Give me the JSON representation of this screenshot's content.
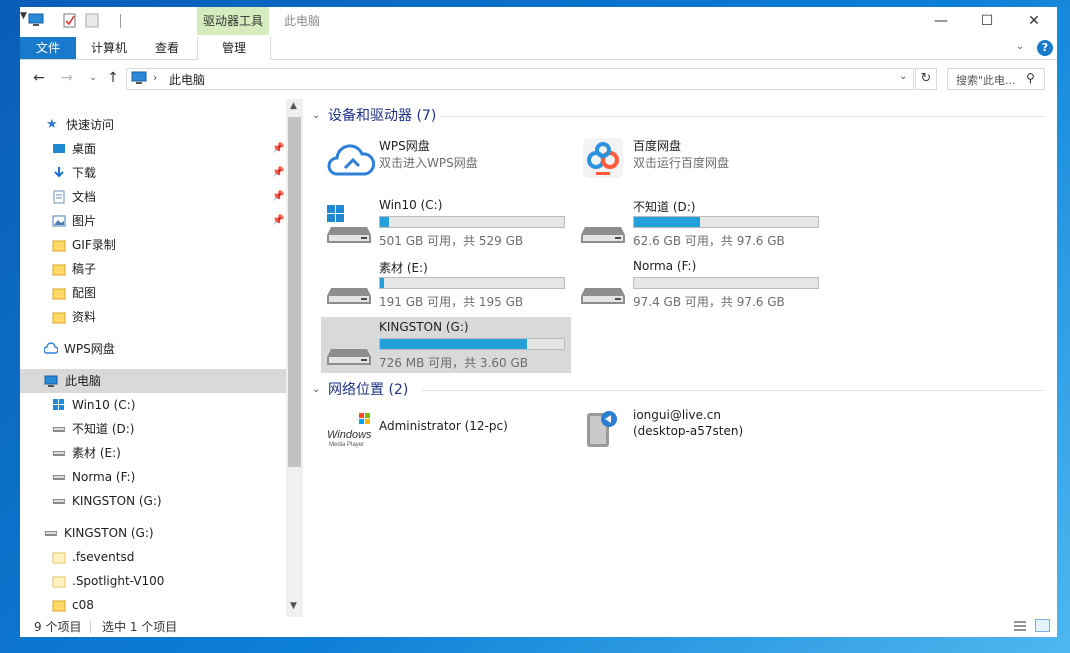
{
  "titlebar": {
    "context_tab": "驱动器工具",
    "window_title": "此电脑",
    "minimize_glyph": "—",
    "maximize_glyph": "☐",
    "close_glyph": "✕"
  },
  "ribbon": {
    "tabs": [
      "文件",
      "计算机",
      "查看",
      "管理"
    ],
    "help_glyph": "?"
  },
  "address": {
    "path": "此电脑",
    "search_placeholder": "搜索\"此电..."
  },
  "nav": {
    "quick_access": "快速访问",
    "quick_items": [
      "桌面",
      "下载",
      "文档",
      "图片",
      "GIF录制",
      "稿子",
      "配图",
      "资料"
    ],
    "wps": "WPS网盘",
    "this_pc": "此电脑",
    "drives": [
      "Win10 (C:)",
      "不知道 (D:)",
      "素材 (E:)",
      "Norma (F:)",
      "KINGSTON (G:)"
    ],
    "kingston": "KINGSTON (G:)",
    "kingston_items": [
      ".fseventsd",
      ".Spotlight-V100",
      "c08"
    ]
  },
  "content": {
    "devices_header": "设备和驱动器 (7)",
    "network_header": "网络位置 (2)",
    "cloud": [
      {
        "name": "WPS网盘",
        "sub": "双击进入WPS网盘"
      },
      {
        "name": "百度网盘",
        "sub": "双击运行百度网盘"
      }
    ],
    "drives": [
      {
        "name": "Win10 (C:)",
        "free": "501 GB 可用，共 529 GB",
        "used_fraction": 0.05
      },
      {
        "name": "不知道 (D:)",
        "free": "62.6 GB 可用，共 97.6 GB",
        "used_fraction": 0.36
      },
      {
        "name": "素材 (E:)",
        "free": "191 GB 可用，共 195 GB",
        "used_fraction": 0.02
      },
      {
        "name": "Norma (F:)",
        "free": "97.4 GB 可用，共 97.6 GB",
        "used_fraction": 0.0
      },
      {
        "name": "KINGSTON (G:)",
        "free": "726 MB 可用，共 3.60 GB",
        "used_fraction": 0.8
      }
    ],
    "network": [
      {
        "name": "Administrator (12-pc)",
        "line2": ""
      },
      {
        "name": "iongui@live.cn",
        "line2": "(desktop-a57sten)"
      }
    ],
    "wmp_logo_text": "Windows",
    "wmp_logo_sub": "Media Player"
  },
  "status": {
    "items": "9 个项目",
    "selected": "选中 1 个项目"
  },
  "colors": {
    "accent": "#1979ca",
    "bar_fill": "#26a0da",
    "selection": "#d9d9d9",
    "header_text": "#1e3287"
  }
}
